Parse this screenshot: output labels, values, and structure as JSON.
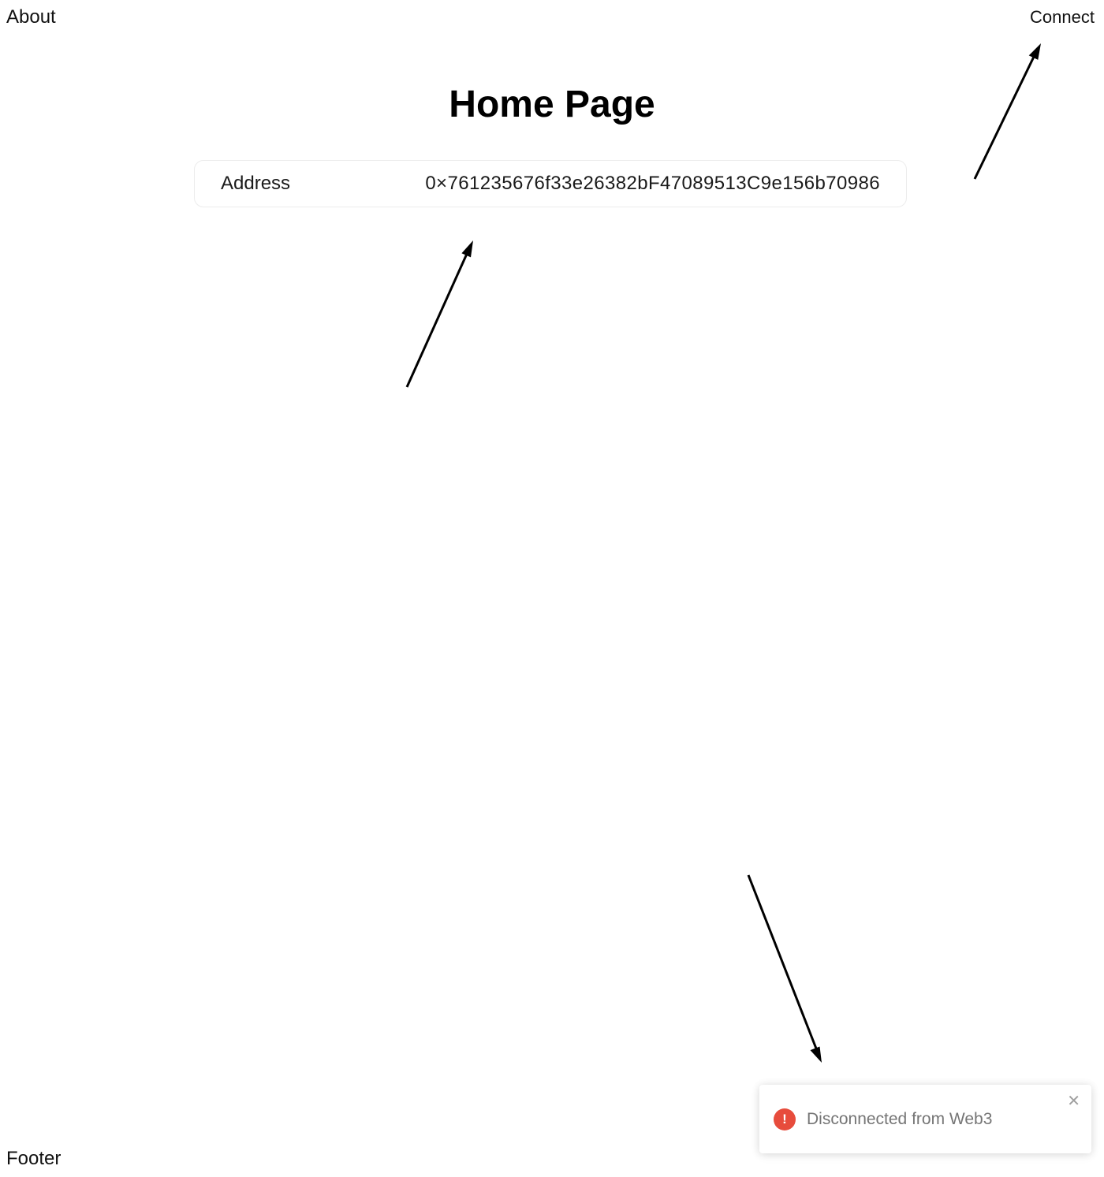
{
  "header": {
    "about_label": "About",
    "connect_label": "Connect"
  },
  "main": {
    "title": "Home Page",
    "address_card": {
      "label": "Address",
      "value": "0×761235676f33e26382bF47089513C9e156b70986"
    }
  },
  "footer": {
    "label": "Footer"
  },
  "toast": {
    "icon": "error-icon",
    "icon_glyph": "!",
    "message": "Disconnected from Web3",
    "close_glyph": "✕",
    "accent_color": "#e74c3c"
  }
}
